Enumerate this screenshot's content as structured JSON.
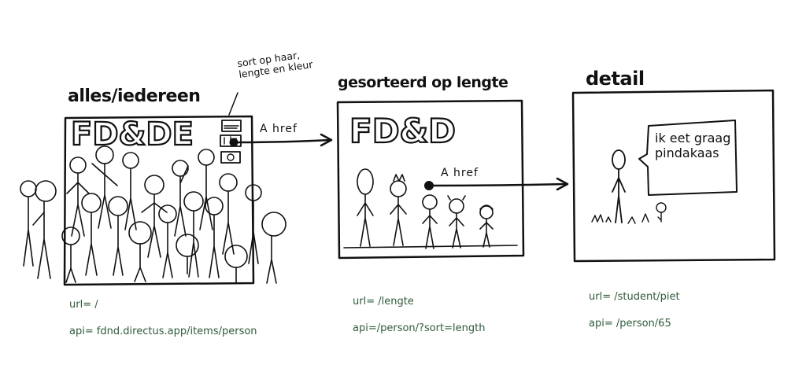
{
  "screens": [
    {
      "title": "alles/iedereen",
      "logo": "FD&DE",
      "note": "sort op haar, lengte en kleur",
      "url": "url= /",
      "api": "api= fdnd.directus.app/items/person"
    },
    {
      "title": "gesorteerd op lengte",
      "logo": "FD&D",
      "url": "url= /lengte",
      "api": "api=/person/?sort=length"
    },
    {
      "title": "detail",
      "speech": "ik eet graag pindakaas",
      "url": "url= /student/piet",
      "api": "api= /person/65"
    }
  ],
  "links": [
    {
      "label": "A href"
    },
    {
      "label": "A href"
    }
  ]
}
